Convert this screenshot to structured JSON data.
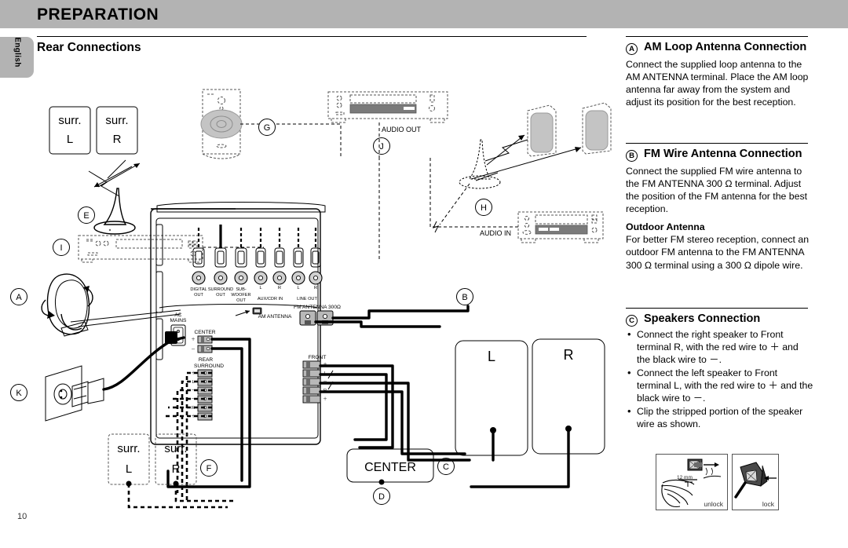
{
  "header": {
    "banner_title": "PREPARATION",
    "language_tab": "English",
    "section_heading": "Rear Connections",
    "page_number": "10"
  },
  "sections": [
    {
      "marker": "A",
      "title": "AM Loop Antenna Connection",
      "body": "Connect the supplied loop antenna to the AM ANTENNA terminal. Place the AM loop antenna far away from the system and adjust its position for the best reception."
    },
    {
      "marker": "B",
      "title": "FM Wire Antenna Connection",
      "body": "Connect the supplied FM wire antenna to the FM ANTENNA 300 Ω terminal. Adjust the position of the FM antenna for the best reception.",
      "sub_heading": "Outdoor Antenna",
      "sub_body": "For better FM stereo reception, connect an outdoor FM antenna to the FM ANTENNA 300 Ω terminal using a 300 Ω dipole wire."
    },
    {
      "marker": "C",
      "title": "Speakers Connection",
      "bullets": [
        "Connect the right speaker to Front terminal R, with the red wire to ＋ and the black wire to －.",
        "Connect the left speaker to Front terminal L, with the red wire to ＋ and the black wire to －.",
        "Clip the stripped portion of the speaker wire as shown."
      ]
    }
  ],
  "clip_figures": [
    {
      "caption": "unlock",
      "dimension": "12 mm"
    },
    {
      "caption": "lock",
      "dimension": ""
    }
  ],
  "diagram": {
    "callouts": [
      "A",
      "B",
      "C",
      "D",
      "E",
      "F",
      "G",
      "H",
      "I",
      "J",
      "K"
    ],
    "speaker_boxes": [
      {
        "name": "surround-left-top",
        "line1": "surr.",
        "line2": "L"
      },
      {
        "name": "surround-right-top",
        "line1": "surr.",
        "line2": "R"
      },
      {
        "name": "surround-left-bottom",
        "line1": "surr.",
        "line2": "L"
      },
      {
        "name": "surround-right-bottom",
        "line1": "surr.",
        "line2": "R"
      },
      {
        "name": "front-left",
        "line1": "",
        "line2": "L"
      },
      {
        "name": "front-right",
        "line1": "",
        "line2": "R"
      },
      {
        "name": "center",
        "line1": "",
        "line2": "CENTER"
      }
    ],
    "device_labels": {
      "audio_out": "AUDIO OUT",
      "audio_in": "AUDIO IN"
    },
    "panel_jacks": [
      "DIGITAL OUT",
      "SURROUND OUT",
      "SUB- WOOFER OUT",
      "L",
      "R",
      "L",
      "R"
    ],
    "panel_jack_groups": [
      "AUX/CDR IN",
      "LINE OUT"
    ],
    "panel_labels": {
      "ac_mains": "AC MAINS",
      "am_antenna": "AM ANTENNA",
      "fm_antenna": "FM ANTENNA 300Ω",
      "center": "CENTER",
      "rear_surround_line1": "REAR",
      "rear_surround_line2": "SURROUND",
      "front": "FRONT"
    },
    "terminal_marks": {
      "plus": "＋",
      "minus": "－",
      "left": "L",
      "right": "R"
    }
  }
}
